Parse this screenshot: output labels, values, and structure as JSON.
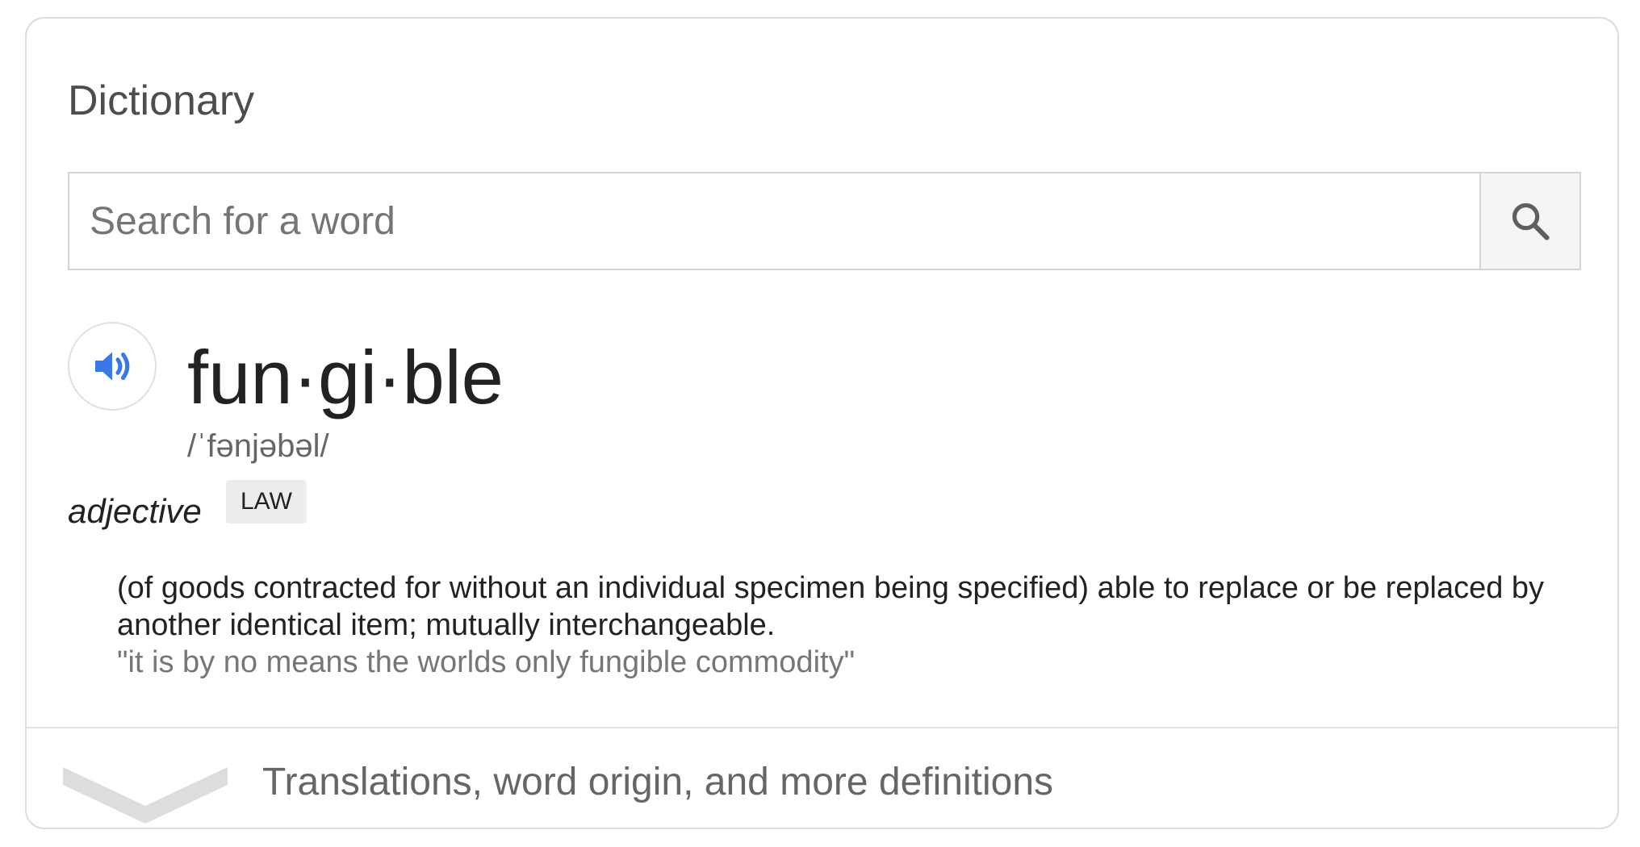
{
  "widget": {
    "title": "Dictionary"
  },
  "search": {
    "placeholder": "Search for a word",
    "value": ""
  },
  "entry": {
    "headword": "fun·gi·ble",
    "phonetic": "/ˈfənjəbəl/",
    "part_of_speech": "adjective",
    "domain_label": "LAW",
    "definition": "(of goods contracted for without an individual specimen being specified) able to replace or be replaced by another identical item; mutually interchangeable.",
    "example": "\"it is by no means the worlds only fungible commodity\""
  },
  "footer": {
    "more_label": "Translations, word origin, and more definitions"
  },
  "icons": {
    "search": "search-icon",
    "speaker": "speaker-icon",
    "expand": "chevron-down-icon"
  },
  "colors": {
    "speaker_blue": "#3b78e7",
    "chevron_gray": "#dddddd",
    "search_icon": "#5f5f5f"
  }
}
